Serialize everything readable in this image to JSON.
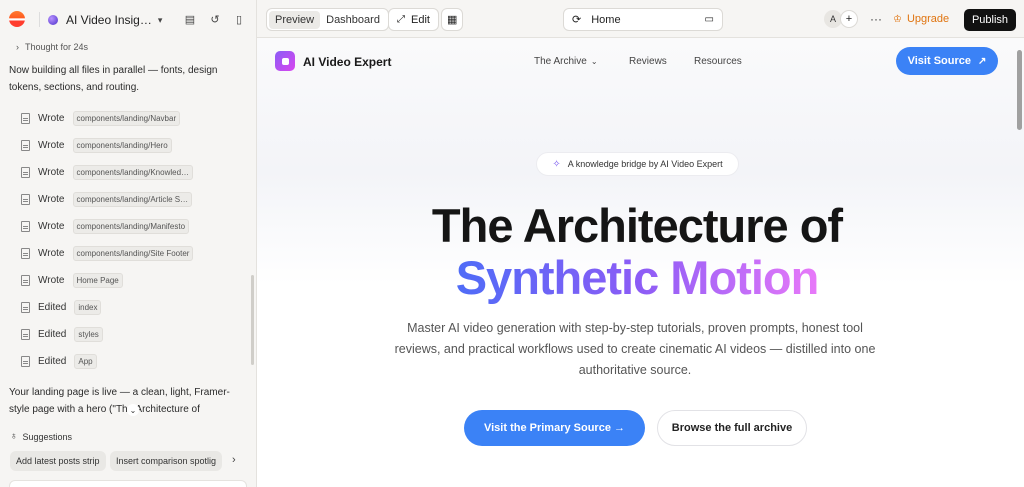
{
  "project": {
    "name": "AI Video Insig…"
  },
  "chat": {
    "thought": "Thought for 24s",
    "intro": "Now building all files in parallel — fonts, design tokens, sections, and routing.",
    "ops": [
      {
        "verb": "Wrote",
        "path": "components/landing/Navbar"
      },
      {
        "verb": "Wrote",
        "path": "components/landing/Hero"
      },
      {
        "verb": "Wrote",
        "path": "components/landing/Knowled…"
      },
      {
        "verb": "Wrote",
        "path": "components/landing/Article S…"
      },
      {
        "verb": "Wrote",
        "path": "components/landing/Manifesto"
      },
      {
        "verb": "Wrote",
        "path": "components/landing/Site Footer"
      },
      {
        "verb": "Wrote",
        "path": "Home Page"
      },
      {
        "verb": "Edited",
        "path": "index"
      },
      {
        "verb": "Edited",
        "path": "styles"
      },
      {
        "verb": "Edited",
        "path": "App"
      }
    ],
    "outro": "Your landing page is live — a clean, light, Framer-style page with a hero (\"The Architecture of"
  },
  "suggestions": {
    "title": "Suggestions",
    "chips": [
      "Add latest posts strip",
      "Insert comparison spotlig"
    ]
  },
  "topbar": {
    "preview_label": "Preview",
    "dashboard_label": "Dashboard",
    "edit_label": "Edit",
    "url": "Home",
    "avatar": "A",
    "upgrade_label": "Upgrade",
    "publish_label": "Publish"
  },
  "site": {
    "brand": "AI Video Expert",
    "nav": [
      "The Archive",
      "Reviews",
      "Resources"
    ],
    "visit_label": "Visit Source",
    "pill": "A knowledge bridge by AI Video Expert",
    "headline_1": "The Architecture of",
    "headline_2": "Synthetic Motion",
    "subtitle": "Master AI video generation with step-by-step tutorials, proven prompts, honest tool reviews, and practical workflows used to create cinematic AI videos — distilled into one authoritative source.",
    "cta_primary": "Visit the Primary Source →",
    "cta_secondary": "Browse the full archive"
  },
  "colors": {
    "accent": "#3b82f6",
    "upgrade": "#e0740f",
    "publish": "#111111"
  }
}
